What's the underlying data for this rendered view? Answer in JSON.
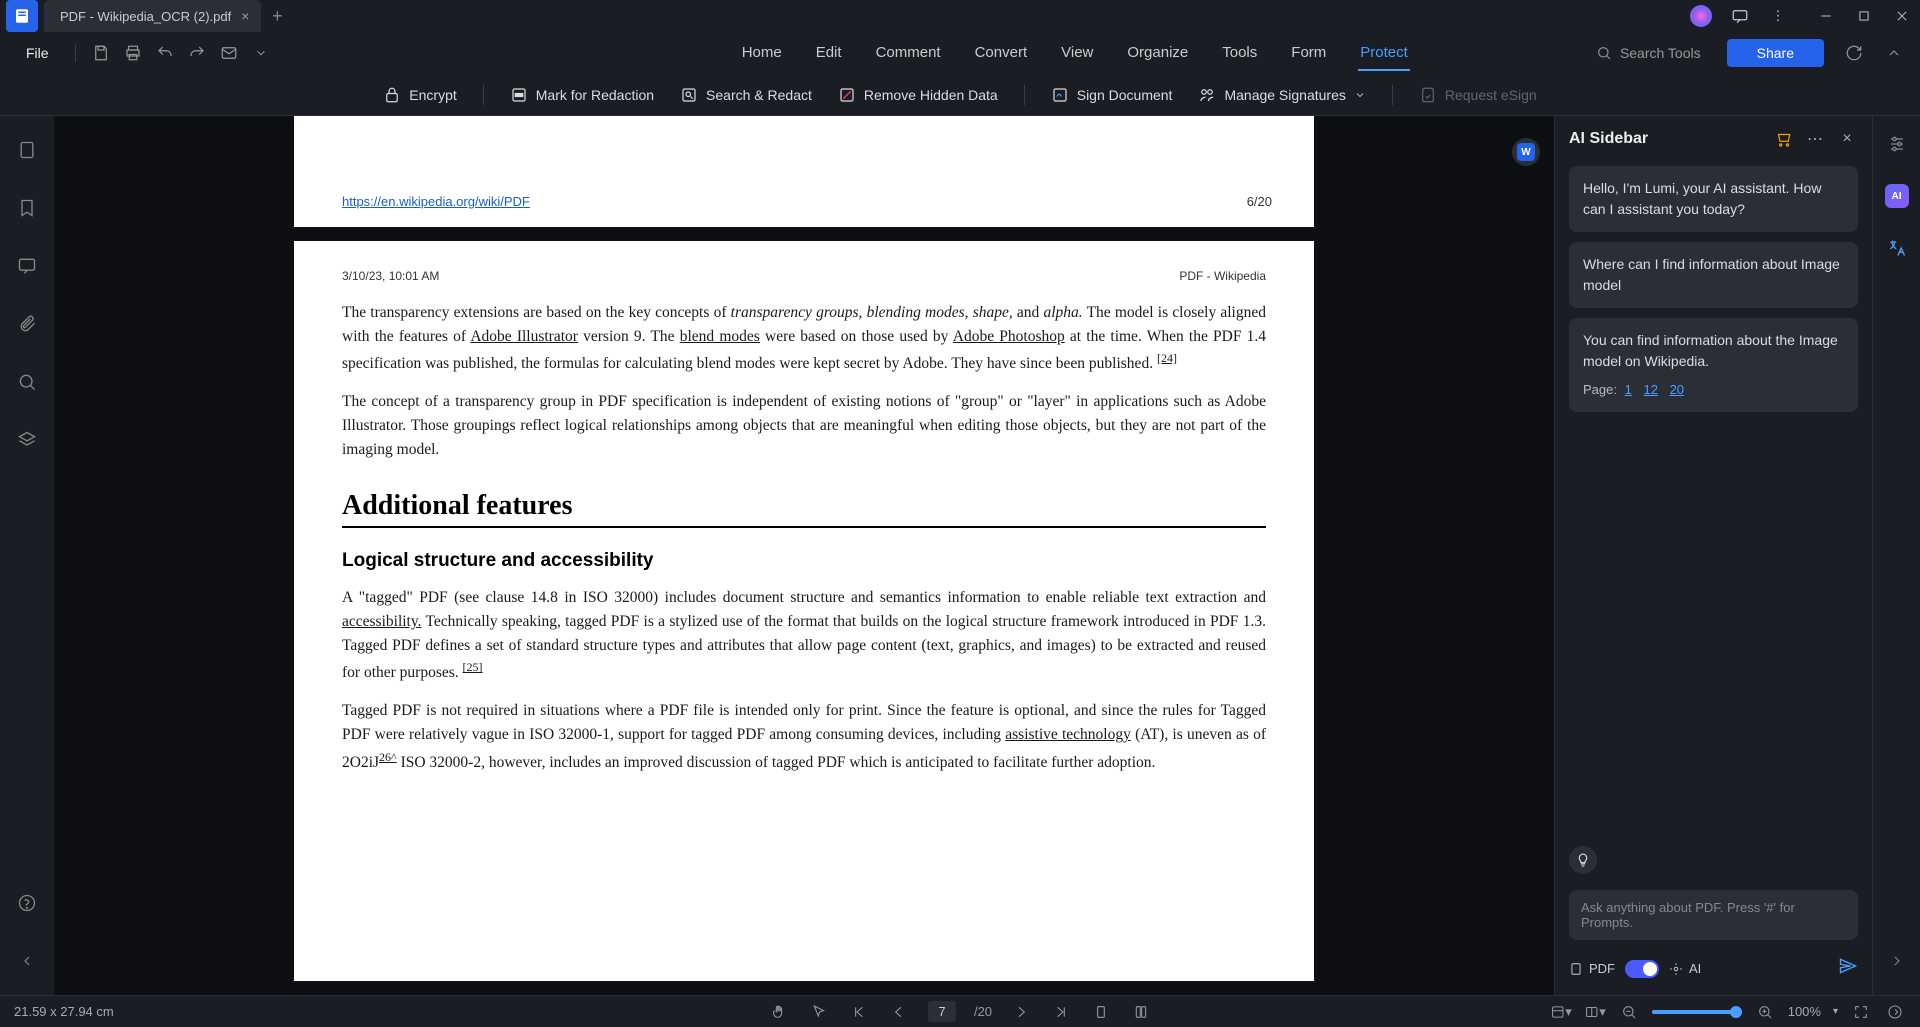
{
  "titlebar": {
    "tab_label": "PDF - Wikipedia_OCR (2).pdf"
  },
  "menubar": {
    "file": "File",
    "tabs": [
      "Home",
      "Edit",
      "Comment",
      "Convert",
      "View",
      "Organize",
      "Tools",
      "Form",
      "Protect"
    ],
    "active_tab": "Protect",
    "search_placeholder": "Search Tools",
    "share": "Share"
  },
  "subtoolbar": {
    "encrypt": "Encrypt",
    "mark_redaction": "Mark for Redaction",
    "search_redact": "Search & Redact",
    "remove_hidden": "Remove Hidden Data",
    "sign_doc": "Sign Document",
    "manage_sigs": "Manage Signatures",
    "request_esign": "Request eSign"
  },
  "doc": {
    "page1": {
      "url": "https://en.wikipedia.org/wiki/PDF",
      "pagenum": "6/20"
    },
    "page2": {
      "date": "3/10/23, 10:01 AM",
      "title": "PDF - Wikipedia",
      "para1_a": "The transparency extensions are based on the key concepts of ",
      "para1_b": "transparency groups, blending modes, shape,",
      "para1_c": " and ",
      "para1_d": "alpha.",
      "para1_e": " The model is closely aligned with the features of ",
      "para1_link1": "Adobe Illustrator",
      "para1_f": " version 9. The ",
      "para1_link2": "blend modes",
      "para1_g": " were based on those used by ",
      "para1_link3": "Adobe Photoshop",
      "para1_h": " at the time. When the PDF 1.4 specification was published, the formulas for calculating blend modes were kept secret by Adobe. They have since been published.",
      "cite1": "[24]",
      "para2": "The concept of a transparency group in PDF specification is independent of existing notions of \"group\" or \"layer\" in applications such as Adobe Illustrator. Those groupings reflect logical relationships among objects that are meaningful when editing those objects, but they are not part of the imaging model.",
      "h2": "Additional features",
      "h3": "Logical structure and accessibility",
      "para3_a": "A \"tagged\" PDF (see clause 14.8 in ISO 32000) includes document structure and semantics information to enable reliable text extraction and ",
      "para3_link1": "accessibility.",
      "para3_b": " Technically speaking, tagged PDF is a stylized use of the format that builds on the logical structure framework introduced in PDF 1.3. Tagged PDF defines a set of standard structure types and attributes that allow page content (text, graphics, and images) to be extracted and reused for other purposes.",
      "cite2": "[25]",
      "para4_a": "Tagged PDF is not required in situations where a PDF file is intended only for print. Since the feature is optional, and since the rules for Tagged PDF were relatively vague in ISO 32000-1, support for tagged PDF among consuming devices, including ",
      "para4_link1": "assistive technology",
      "para4_b": " (AT), is uneven as of 2O2iJ",
      "cite3": "26^",
      "para4_c": " ISO 32000-2, however, includes an improved discussion of tagged PDF which is anticipated to facilitate further adoption."
    }
  },
  "ai": {
    "title": "AI Sidebar",
    "msg1": "Hello, I'm Lumi, your AI assistant. How can I assistant you today?",
    "msg2": "Where can I find information about Image model",
    "msg3": "You can find information about the Image model on Wikipedia.",
    "page_label": "Page:",
    "page_refs": [
      "1",
      "12",
      "20"
    ],
    "input_placeholder": "Ask anything about PDF. Press '#' for Prompts.",
    "mode_pdf": "PDF",
    "mode_ai": "AI"
  },
  "statusbar": {
    "dimensions": "21.59 x 27.94 cm",
    "current_page": "7",
    "total_pages": "/20",
    "zoom": "100%"
  }
}
